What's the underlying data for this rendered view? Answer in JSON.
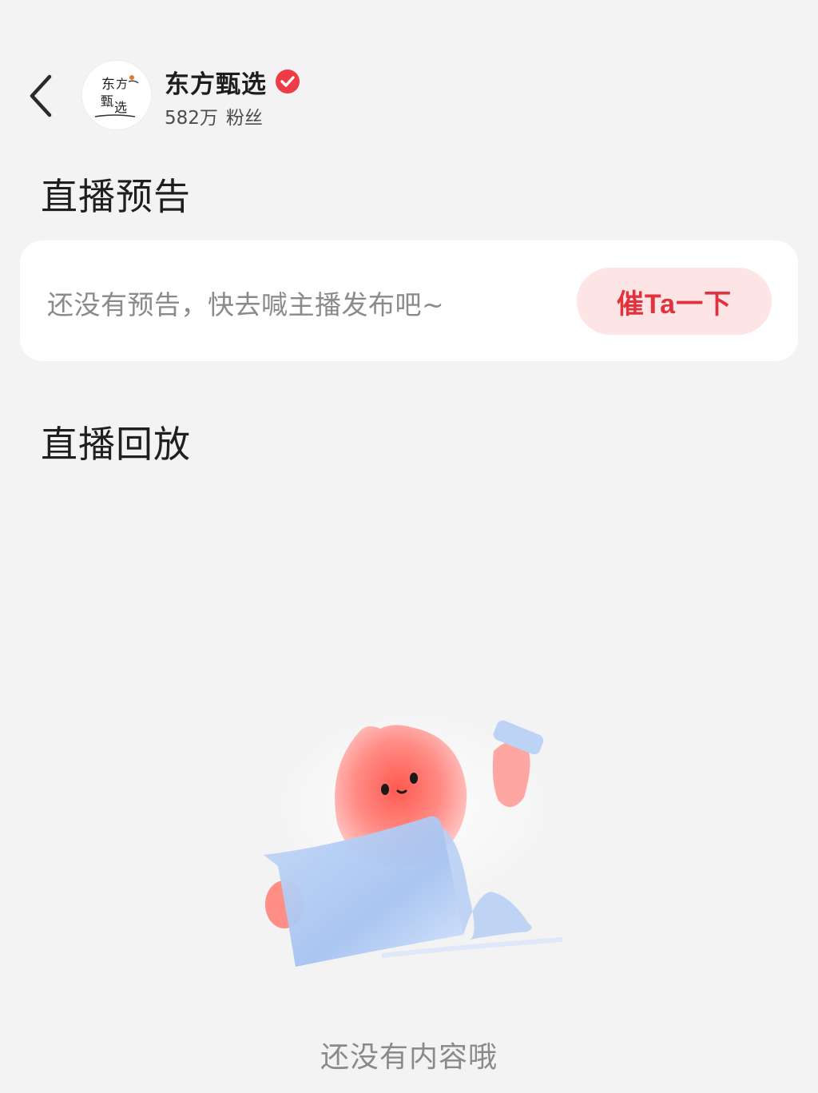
{
  "header": {
    "back_icon": "chevron-left-icon",
    "account_name": "东方甄选",
    "verified_icon": "verified-badge-icon",
    "follower_count": "582万",
    "follower_label": "粉丝",
    "avatar_logo_text": "东方甄选"
  },
  "sections": {
    "preview_title": "直播预告",
    "preview_empty": "还没有预告，快去喊主播发布吧~",
    "urge_button": "催Ta一下",
    "replay_title": "直播回放",
    "replay_empty": "还没有内容哦"
  },
  "colors": {
    "background": "#f3f3f3",
    "card": "#ffffff",
    "accent_red": "#e0333d",
    "accent_pink_bg": "#fde5e5",
    "verified_red": "#ee3b45"
  }
}
